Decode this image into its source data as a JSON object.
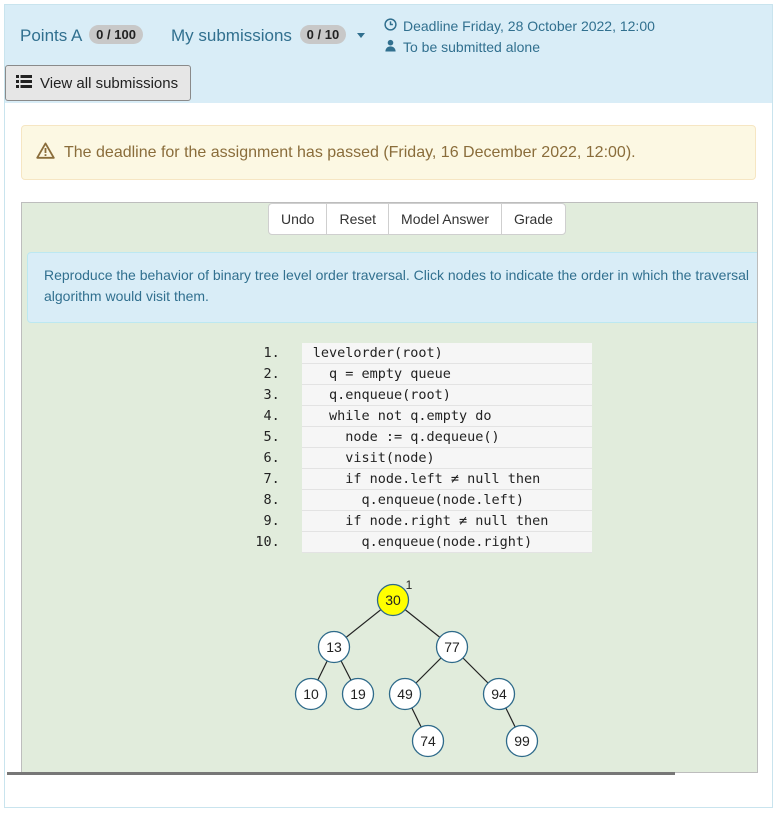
{
  "header": {
    "points_label": "Points A",
    "points_badge": "0 / 100",
    "submissions_label": "My submissions",
    "submissions_badge": "0 / 10",
    "deadline": "Deadline Friday, 28 October 2022, 12:00",
    "submission_mode": "To be submitted alone",
    "view_all_label": "View all submissions"
  },
  "alert": {
    "text": "The deadline for the assignment has passed (Friday, 16 December 2022, 12:00)."
  },
  "toolbar": {
    "undo": "Undo",
    "reset": "Reset",
    "model_answer": "Model Answer",
    "grade": "Grade"
  },
  "instructions": "Reproduce the behavior of binary tree level order traversal. Click nodes to indicate the order in which the traversal algorithm would visit them.",
  "code": [
    {
      "n": "1.",
      "text": "levelorder(root)"
    },
    {
      "n": "2.",
      "text": "  q = empty queue"
    },
    {
      "n": "3.",
      "text": "  q.enqueue(root)"
    },
    {
      "n": "4.",
      "text": "  while not q.empty do"
    },
    {
      "n": "5.",
      "text": "    node := q.dequeue()"
    },
    {
      "n": "6.",
      "text": "    visit(node)"
    },
    {
      "n": "7.",
      "text": "    if node.left ≠ null then"
    },
    {
      "n": "8.",
      "text": "      q.enqueue(node.left)"
    },
    {
      "n": "9.",
      "text": "    if node.right ≠ null then"
    },
    {
      "n": "10.",
      "text": "      q.enqueue(node.right)"
    }
  ],
  "tree": {
    "nodes": [
      {
        "id": "n30",
        "value": "30",
        "visited": true,
        "order": "1"
      },
      {
        "id": "n13",
        "value": "13"
      },
      {
        "id": "n77",
        "value": "77"
      },
      {
        "id": "n10",
        "value": "10"
      },
      {
        "id": "n19",
        "value": "19"
      },
      {
        "id": "n49",
        "value": "49"
      },
      {
        "id": "n94",
        "value": "94"
      },
      {
        "id": "n74",
        "value": "74"
      },
      {
        "id": "n99",
        "value": "99"
      }
    ]
  },
  "colors": {
    "visited_node": "#ffff00",
    "info_text": "#31708f",
    "exercise_bg": "#e1ecdc"
  }
}
